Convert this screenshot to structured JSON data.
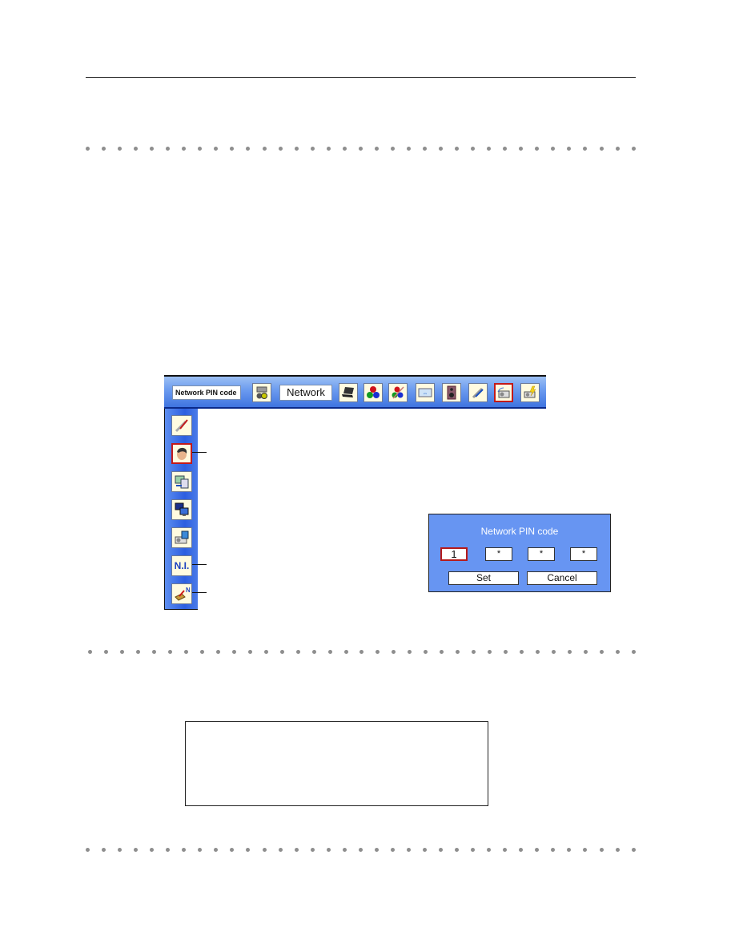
{
  "menu": {
    "title_box": "Network PIN code",
    "network_label": "Network",
    "top_icons": [
      {
        "name": "network-device-icon",
        "selected": false
      },
      {
        "name": "laptop-icon",
        "selected": false
      },
      {
        "name": "color-balls-icon",
        "selected": false
      },
      {
        "name": "color-adjust-icon",
        "selected": false
      },
      {
        "name": "screen-icon",
        "selected": false
      },
      {
        "name": "speaker-icon",
        "selected": false
      },
      {
        "name": "tools-icon",
        "selected": false
      },
      {
        "name": "projector-network-icon",
        "selected": true
      },
      {
        "name": "projector-power-icon",
        "selected": false
      }
    ],
    "side_icons": [
      {
        "name": "tools-icon",
        "selected": false
      },
      {
        "name": "user-head-icon",
        "selected": true
      },
      {
        "name": "network-settings-icon",
        "selected": false
      },
      {
        "name": "computer-network-icon",
        "selected": false
      },
      {
        "name": "projector-info-icon",
        "selected": false
      },
      {
        "name": "network-info-icon",
        "label": "N.I.",
        "selected": false
      },
      {
        "name": "network-factory-default-icon",
        "label": "N",
        "selected": false
      }
    ]
  },
  "dialog": {
    "title": "Network PIN code",
    "pin_digits": [
      "1",
      "*",
      "*",
      "*"
    ],
    "set_label": "Set",
    "cancel_label": "Cancel"
  },
  "colors": {
    "menu_blue": "#3f74e0",
    "dialog_blue": "#6795f2",
    "selection_red": "#c21a1a",
    "dot_gray": "#8e8e8e"
  }
}
